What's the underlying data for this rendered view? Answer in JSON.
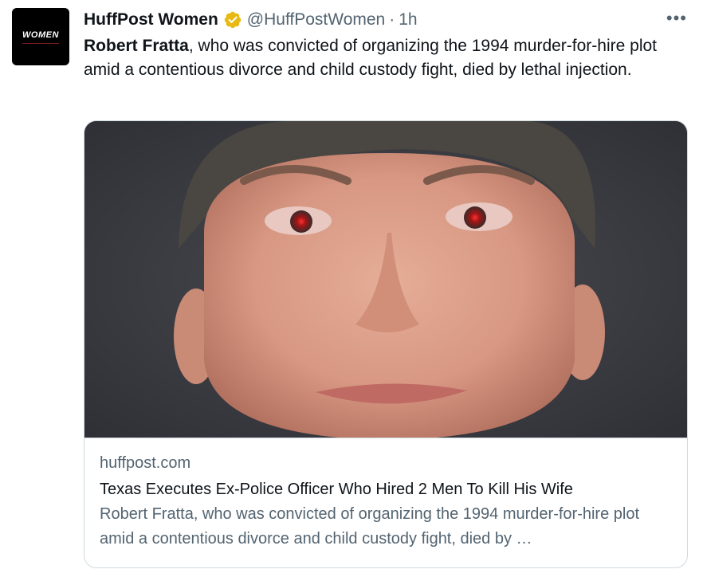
{
  "tweet": {
    "avatar_text": "WOMEN",
    "author_name": "HuffPost Women",
    "handle": "@HuffPostWomen",
    "separator": "·",
    "time": "1h",
    "more_icon": "more-horizontal-icon",
    "verified_icon": "verified-badge-icon",
    "verified_color": "#e8b913",
    "text_bold": "Robert Fratta",
    "text_rest": ", who was convicted of organizing the 1994 murder-for-hire plot amid a contentious divorce and child custody fight, died by lethal injection."
  },
  "card": {
    "domain": "huffpost.com",
    "title": "Texas Executes Ex-Police Officer Who Hired 2 Men To Kill His Wife",
    "description": "Robert Fratta, who was convicted of organizing the 1994 murder-for-hire plot amid a contentious divorce and child custody fight, died by …"
  },
  "colors": {
    "text_primary": "#0f1419",
    "text_secondary": "#536471",
    "border": "#cfd9de"
  }
}
